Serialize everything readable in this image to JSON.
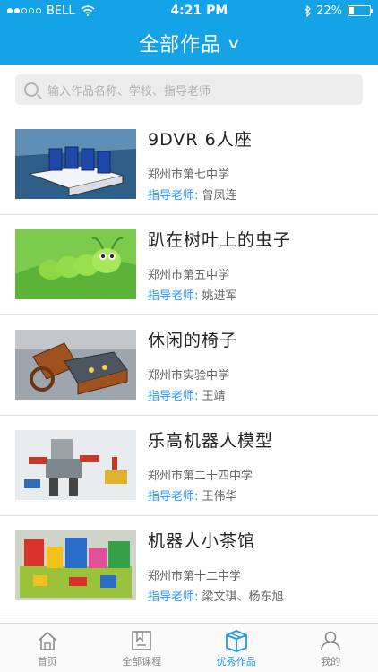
{
  "status": {
    "carrier": "BELL",
    "time": "4:21 PM",
    "battery": "22%",
    "battery_level": 0.22
  },
  "header": {
    "title": "全部作品"
  },
  "search": {
    "placeholder": "输入作品名称、学校、指导老师"
  },
  "works": [
    {
      "name": "9DVR 6人座",
      "school": "郑州市第七中学",
      "teacher_label": "指导老师:",
      "teacher": "曾凤连"
    },
    {
      "name": "趴在树叶上的虫子",
      "school": "郑州市第五中学",
      "teacher_label": "指导老师:",
      "teacher": "姚进军"
    },
    {
      "name": "休闲的椅子",
      "school": "郑州市实验中学",
      "teacher_label": "指导老师:",
      "teacher": "王靖"
    },
    {
      "name": "乐高机器人模型",
      "school": "郑州市第二十四中学",
      "teacher_label": "指导老师:",
      "teacher": "王伟华"
    },
    {
      "name": "机器人小茶馆",
      "school": "郑州市第十二中学",
      "teacher_label": "指导老师:",
      "teacher": "梁文琪、杨东旭"
    }
  ],
  "tabs": [
    {
      "label": "首页",
      "icon": "home-icon"
    },
    {
      "label": "全部课程",
      "icon": "course-icon"
    },
    {
      "label": "优秀作品",
      "icon": "works-icon",
      "active": true
    },
    {
      "label": "我的",
      "icon": "profile-icon"
    }
  ],
  "colors": {
    "brand": "#15a3e8",
    "teacher_label": "#2196f3",
    "tab_active": "#1e9ae6"
  }
}
